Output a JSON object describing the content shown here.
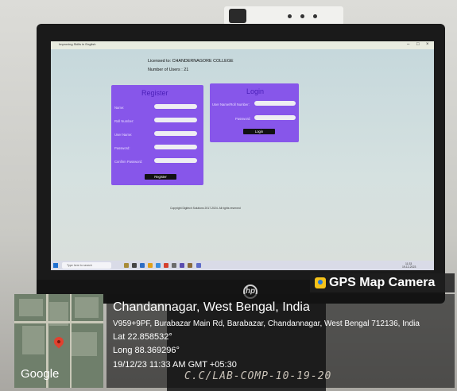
{
  "window": {
    "title": "Improving Skills in English"
  },
  "header": {
    "licensed_to": "Licensed to: CHANDERNAGORE COLLEGE",
    "num_users": "Number of Users : 21"
  },
  "register": {
    "title": "Register",
    "fields": [
      {
        "label": "Name:"
      },
      {
        "label": "Roll Number:"
      },
      {
        "label": "User Name:"
      },
      {
        "label": "Password:"
      },
      {
        "label": "Confirm Password:"
      }
    ],
    "button": "Register"
  },
  "login": {
    "title": "Login",
    "fields": [
      {
        "label": "User Name/Roll Number:"
      },
      {
        "label": "Password:"
      }
    ],
    "button": "Login"
  },
  "footer": {
    "copyright": "Copyright Digitech Solutions 2017-2024. All rights reserved"
  },
  "taskbar": {
    "search_placeholder": "Type here to search",
    "clock_time": "11:33",
    "clock_date": "19-12-2023"
  },
  "overlay": {
    "brand": "GPS Map Camera",
    "place": "Chandannagar, West Bengal, India",
    "address": "V959+9PF, Burabazar Main Rd, Barabazar, Chandannagar, West Bengal 712136, India",
    "lat": "Lat 22.858532°",
    "long": "Long 88.369296°",
    "datetime": "19/12/23 11:33 AM GMT +05:30",
    "map_attribution": "Google"
  },
  "label_on_stand": "C.C/LAB-COMP-10-19-20",
  "colors": {
    "panel": "#8756ea",
    "panel_title": "#4a1fb8",
    "screen_bg": "#c6d8dc"
  }
}
